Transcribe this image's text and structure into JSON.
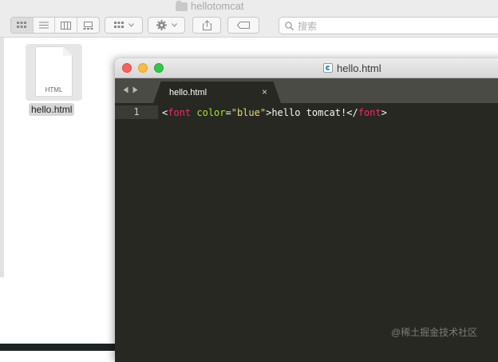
{
  "finder": {
    "title": "hellotomcat",
    "search_placeholder": "搜索",
    "file": {
      "name": "hello.html",
      "icon_label": "HTML"
    }
  },
  "editor": {
    "window_title": "hello.html",
    "tab_label": "hello.html",
    "tab_close": "×",
    "line_number": "1",
    "code": {
      "open_lt": "<",
      "tag": "font",
      "attr": "color",
      "eq": "=",
      "value": "\"blue\"",
      "open_gt": ">",
      "text": "hello tomcat!",
      "close_lt": "</",
      "close_tag": "font",
      "close_gt": ">"
    }
  },
  "watermark": "@稀土掘金技术社区",
  "colors": {
    "editor_bg": "#272822",
    "tag": "#f92672",
    "attr": "#a6e22e",
    "string": "#e6db74"
  }
}
